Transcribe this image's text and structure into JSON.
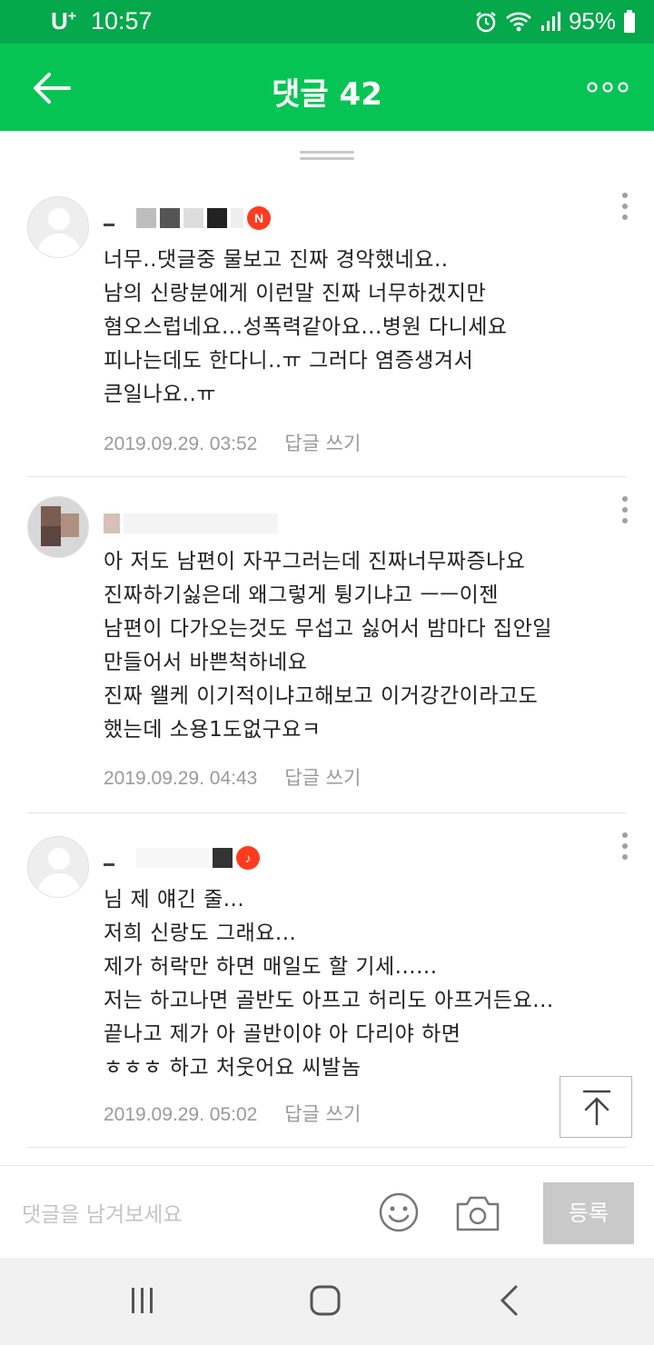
{
  "status": {
    "carrier": "U",
    "carrier_plus": "+",
    "time": "10:57",
    "battery": "95%"
  },
  "header": {
    "title": "댓글 42"
  },
  "comments": [
    {
      "lines": [
        "너무..댓글중 물보고 진짜 경악했네요..",
        "남의 신랑분에게 이런말 진짜 너무하겠지만",
        "혐오스럽네요...성폭력같아요...병원 다니세요",
        "피나는데도 한다니..ㅠ 그러다 염증생겨서",
        "큰일나요..ㅠ"
      ],
      "date": "2019.09.29. 03:52",
      "reply": "답글 쓰기",
      "badge": "N"
    },
    {
      "lines": [
        "아 저도 남편이 자꾸그러는데 진짜너무짜증나요",
        "진짜하기싫은데 왜그렇게 튕기냐고 ㅡㅡ이젠",
        "남편이 다가오는것도 무섭고 싫어서 밤마다 집안일",
        "만들어서 바쁜척하네요",
        "진짜 왤케 이기적이냐고해보고 이거강간이라고도",
        "했는데 소용1도없구요ㅋ"
      ],
      "date": "2019.09.29. 04:43",
      "reply": "답글 쓰기"
    },
    {
      "lines": [
        "님 제 얘긴 줄...",
        "저희 신랑도 그래요...",
        "제가 허락만 하면 매일도 할 기세......",
        "저는 하고나면 골반도 아프고 허리도 아프거든요...",
        "끝나고 제가 아 골반이야 아 다리야 하면",
        "ㅎㅎㅎ 하고 처웃어요 씨발놈"
      ],
      "date": "2019.09.29. 05:02",
      "reply": "답글 쓰기"
    }
  ],
  "input": {
    "placeholder": "댓글을 남겨보세요",
    "submit": "등록"
  },
  "colors": {
    "status_bar": "#05a84a",
    "header": "#06c454",
    "badge": "#ff3b1f"
  }
}
